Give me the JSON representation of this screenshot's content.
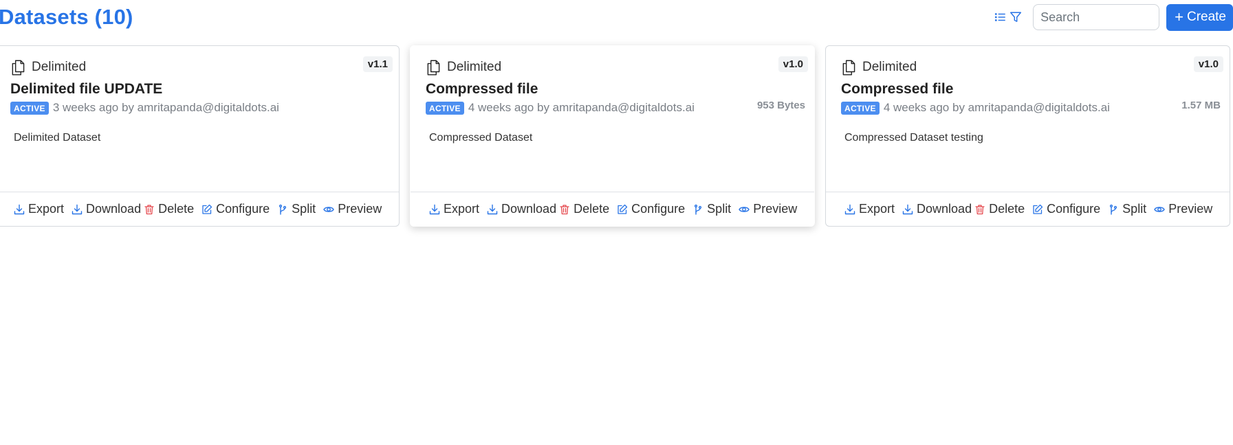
{
  "header": {
    "title": "Datasets (10)"
  },
  "toolbar": {
    "search_placeholder": "Search",
    "create_label": "Create",
    "list_icon": "list-icon",
    "filter_icon": "filter-icon"
  },
  "colors": {
    "accent": "#2874e6",
    "active_badge": "#4c8ef0",
    "delete": "#e5484d"
  },
  "actions": {
    "export": "Export",
    "download": "Download",
    "delete": "Delete",
    "configure": "Configure",
    "split": "Split",
    "preview": "Preview"
  },
  "cards": [
    {
      "type": "Delimited",
      "version": "v1.1",
      "title": "Delimited file UPDATE",
      "status": "ACTIVE",
      "meta": "3 weeks ago by amritapanda@digitaldots.ai",
      "size": "",
      "description": "Delimited Dataset"
    },
    {
      "type": "Delimited",
      "version": "v1.0",
      "title": "Compressed file",
      "status": "ACTIVE",
      "meta": "4 weeks ago by amritapanda@digitaldots.ai",
      "size": "953 Bytes",
      "description": "Compressed Dataset"
    },
    {
      "type": "Delimited",
      "version": "v1.0",
      "title": "Compressed file",
      "status": "ACTIVE",
      "meta": "4 weeks ago by amritapanda@digitaldots.ai",
      "size": "1.57 MB",
      "description": "Compressed Dataset testing"
    }
  ]
}
